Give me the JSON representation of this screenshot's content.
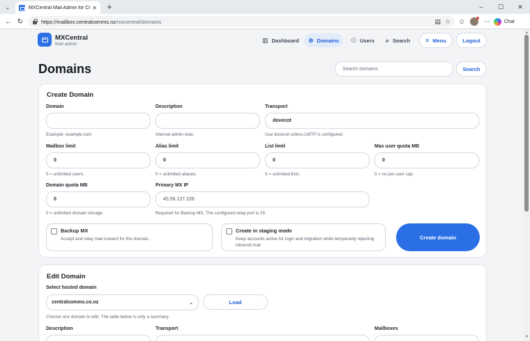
{
  "browser": {
    "tab_title": "MXCentral Mail Admin for CCL",
    "url_host": "https://mailbox.centralcomms.nz",
    "url_path": "/mxcentral/domains",
    "chat_label": "Chat"
  },
  "header": {
    "brand": "MXCentral",
    "subtitle": "Mail admin",
    "nav": [
      {
        "label": "Dashboard",
        "icon": "dashboard-icon"
      },
      {
        "label": "Domains",
        "icon": "globe-icon",
        "active": true
      },
      {
        "label": "Users",
        "icon": "users-icon"
      },
      {
        "label": "Search",
        "icon": "search-icon"
      }
    ],
    "menu_label": "Menu",
    "logout_label": "Logout"
  },
  "page": {
    "title": "Domains",
    "search_placeholder": "Search domains",
    "search_button": "Search"
  },
  "create": {
    "title": "Create Domain",
    "domain": {
      "label": "Domain",
      "value": "",
      "hint": "Example: example.com"
    },
    "description": {
      "label": "Description",
      "value": "",
      "hint": "Internal admin note."
    },
    "transport": {
      "label": "Transport",
      "value": "dovecot",
      "hint": "Use dovecot unless LMTP is configured."
    },
    "mailbox_limit": {
      "label": "Mailbox limit",
      "value": "0",
      "hint": "0 = unlimited users."
    },
    "alias_limit": {
      "label": "Alias limit",
      "value": "0",
      "hint": "0 = unlimited aliases."
    },
    "list_limit": {
      "label": "List limit",
      "value": "0",
      "hint": "0 = unlimited lists."
    },
    "max_user_quota": {
      "label": "Max user quota MB",
      "value": "0",
      "hint": "0 = no per-user cap."
    },
    "domain_quota": {
      "label": "Domain quota MB",
      "value": "0",
      "hint": "0 = unlimited domain storage."
    },
    "primary_mx_ip": {
      "label": "Primary MX IP",
      "value": "45.56.127.226",
      "hint": "Required for Backup MX. The configured relay port is 25."
    },
    "backup_mx": {
      "title": "Backup MX",
      "desc": "Accept and relay mail onward for this domain.",
      "checked": false
    },
    "staging": {
      "title": "Create in staging mode",
      "desc_line1": "Keep accounts active for login and migration while temporarily rejecting",
      "desc_line2": "inbound mail.",
      "checked": false
    },
    "submit_label": "Create domain"
  },
  "edit": {
    "title": "Edit Domain",
    "select_label": "Select hosted domain",
    "selected_domain": "centralcomms.co.nz",
    "load_label": "Load",
    "hint": "Choose one domain to edit. The table below is only a summary.",
    "col_description": "Description",
    "col_transport": "Transport",
    "col_mailboxes": "Mailboxes"
  }
}
